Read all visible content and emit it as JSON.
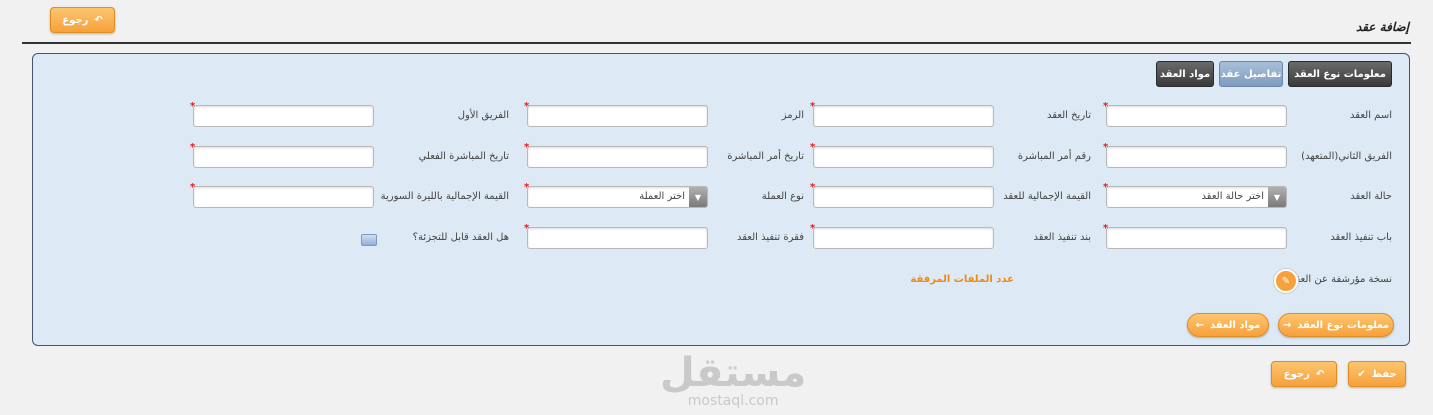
{
  "header": {
    "back_label": "رجوع",
    "page_title": "إضافة عقد"
  },
  "tabs": {
    "contract_type_info": "معلومات نوع العقد",
    "contract_details": "تفاصيل عقد",
    "contract_items": "مواد العقد"
  },
  "fields": {
    "contract_name": "اسم العقد",
    "contract_date": "تاريخ العقد",
    "code": "الرمز",
    "first_party": "الفريق الأول",
    "second_party": "الفريق الثاني(المتعهد)",
    "start_order_number": "رقم أمر المباشرة",
    "start_order_date": "تاريخ أمر المباشرة",
    "actual_start_date": "تاريخ المباشرة الفعلي",
    "contract_status": "حالة العقد",
    "contract_status_placeholder": "اختر حالة العقد",
    "total_value": "القيمة الإجمالية للعقد",
    "currency_type": "نوع العملة",
    "currency_placeholder": "اختر العملة",
    "total_value_syp": "القيمة الإجمالية بالليرة السورية",
    "execution_chapter": "باب تنفيذ العقد",
    "execution_item": "بند تنفيذ العقد",
    "execution_paragraph": "فقرة تنفيذ العقد",
    "divisible": "هل العقد قابل للتجزئة؟"
  },
  "attachment": {
    "archived_copy_label": "نسخة مؤرشفة عن العقد",
    "attached_files_label": "عدد الملفات المرفقة"
  },
  "panel_nav": {
    "next_label": "معلومات نوع العقد",
    "prev_label": "مواد العقد"
  },
  "footer": {
    "save_label": "حفظ",
    "back_label": "رجوع"
  },
  "watermark": {
    "arabic": "مستقل",
    "latin": "mostaql.com"
  },
  "colors": {
    "accent_orange": "#f7a13b",
    "panel_background": "#dde9f5",
    "required_mark": "#e01b1b"
  }
}
